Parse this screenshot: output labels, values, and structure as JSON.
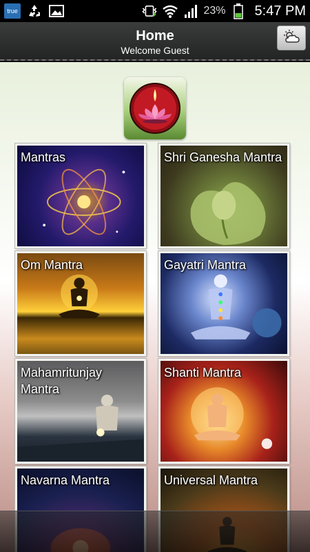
{
  "status_bar": {
    "carrier_badge": "true",
    "battery_percent": "23%",
    "time": "5:47 PM",
    "icons": [
      "true-app-icon",
      "recycle-icon",
      "image-icon",
      "vibrate-icon",
      "wifi-icon",
      "signal-icon",
      "battery-icon"
    ]
  },
  "header": {
    "title": "Home",
    "subtitle": "Welcome Guest",
    "right_button_icon": "weather-cloud-icon"
  },
  "logo": {
    "icon": "lotus-lamp-logo"
  },
  "tiles": [
    {
      "label": "Mantras"
    },
    {
      "label": "Shri Ganesha Mantra"
    },
    {
      "label": "Om Mantra"
    },
    {
      "label": "Gayatri Mantra"
    },
    {
      "label": "Mahamritunjay Mantra"
    },
    {
      "label": "Shanti Mantra"
    },
    {
      "label": "Navarna Mantra"
    },
    {
      "label": "Universal Mantra"
    }
  ],
  "colors": {
    "header_bg": "#2e2f2f",
    "status_bar_bg": "#000000",
    "battery_green": "#5ec83a"
  }
}
